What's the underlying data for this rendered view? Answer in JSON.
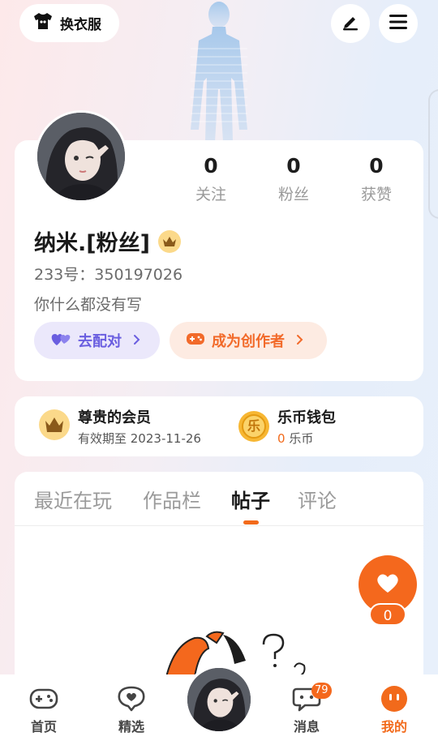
{
  "topbar": {
    "wardrobe_label": "换衣服",
    "edit_icon": "pencil-icon",
    "menu_icon": "hamburger-menu-icon"
  },
  "profile": {
    "stats": [
      {
        "value": "0",
        "label": "关注"
      },
      {
        "value": "0",
        "label": "粉丝"
      },
      {
        "value": "0",
        "label": "获赞"
      }
    ],
    "username": "纳米.[粉丝]",
    "uid_text": "233号：350197026",
    "bio": "你什么都没有写",
    "match_label": "去配对",
    "creator_label": "成为创作者"
  },
  "vip": {
    "member_title": "尊贵的会员",
    "member_expiry": "有效期至 2023-11-26",
    "wallet_title": "乐币钱包",
    "wallet_amount": "0",
    "wallet_unit": " 乐币",
    "coin_char": "乐"
  },
  "tabs": [
    {
      "label": "最近在玩"
    },
    {
      "label": "作品栏"
    },
    {
      "label": "帖子"
    },
    {
      "label": "评论"
    }
  ],
  "active_tab": "帖子",
  "like": {
    "count": "0"
  },
  "bottom_nav": {
    "home": "首页",
    "featured": "精选",
    "messages": "消息",
    "messages_badge": "79",
    "mine": "我的"
  },
  "colors": {
    "accent": "#f26a1b",
    "match_text": "#6a5ee0",
    "vip_gold": "#fbd98a"
  }
}
